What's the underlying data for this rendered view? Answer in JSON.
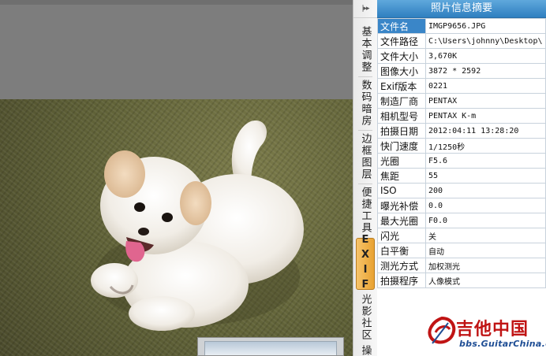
{
  "canvas": {
    "photo_subject": "white-puppy-photo"
  },
  "side_tabs": {
    "collapse_label": "|▸▸",
    "tabs": [
      {
        "label": "基本调整",
        "active": false
      },
      {
        "label": "数码暗房",
        "active": false
      },
      {
        "label": "边框图层",
        "active": false
      },
      {
        "label": "便捷工具",
        "active": false
      },
      {
        "label": "EXIF",
        "active": true
      },
      {
        "label": "光影社区",
        "active": false
      },
      {
        "label": "操",
        "active": false
      }
    ]
  },
  "exif_panel": {
    "title": "照片信息摘要",
    "rows": [
      {
        "key": "文件名",
        "value": "IMGP9656.JPG"
      },
      {
        "key": "文件路径",
        "value": "C:\\Users\\johnny\\Desktop\\"
      },
      {
        "key": "文件大小",
        "value": "3,670K"
      },
      {
        "key": "图像大小",
        "value": "3872 * 2592"
      },
      {
        "key": "Exif版本",
        "value": "0221"
      },
      {
        "key": "制造厂商",
        "value": "PENTAX"
      },
      {
        "key": "相机型号",
        "value": "PENTAX K-m"
      },
      {
        "key": "拍摄日期",
        "value": "2012:04:11 13:28:20"
      },
      {
        "key": "快门速度",
        "value": "1/1250秒"
      },
      {
        "key": "光圈",
        "value": "F5.6"
      },
      {
        "key": "焦距",
        "value": "55"
      },
      {
        "key": "ISO",
        "value": "200"
      },
      {
        "key": "曝光补偿",
        "value": "0.0"
      },
      {
        "key": "最大光圈",
        "value": "F0.0"
      },
      {
        "key": "闪光",
        "value": "关"
      },
      {
        "key": "白平衡",
        "value": "自动"
      },
      {
        "key": "测光方式",
        "value": "加权测光"
      },
      {
        "key": "拍摄程序",
        "value": "人像模式"
      }
    ]
  },
  "watermark": {
    "cn": "吉他中国",
    "en": "bbs.GuitarChina.com"
  },
  "colors": {
    "panel_title": "#3a86c8",
    "active_tab": "#f0b04a",
    "watermark_red": "#c01414"
  }
}
